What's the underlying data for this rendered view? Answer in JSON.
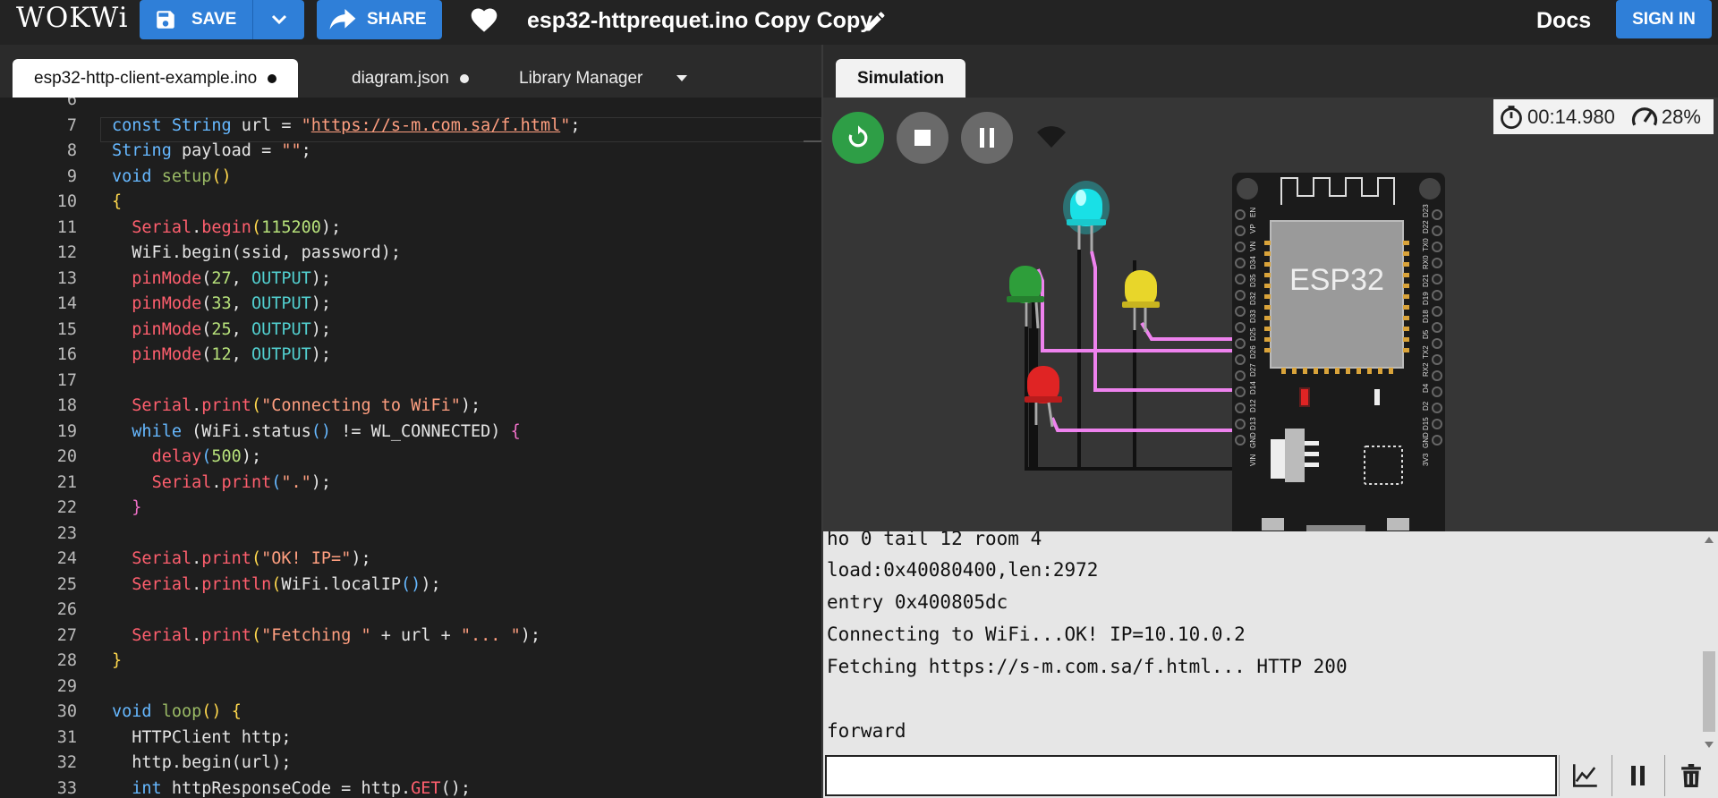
{
  "header": {
    "logo": "WOKWi",
    "save_label": "SAVE",
    "share_label": "SHARE",
    "project_title": "esp32-httprequet.ino Copy Copy",
    "docs_label": "Docs",
    "signin_label": "SIGN IN"
  },
  "editor_tabs": [
    {
      "label": "esp32-http-client-example.ino",
      "modified": true
    },
    {
      "label": "diagram.json",
      "modified": true
    },
    {
      "label": "Library Manager"
    }
  ],
  "simulation": {
    "tab_label": "Simulation",
    "timer": "00:14.980",
    "speed": "28%",
    "board_label": "ESP32",
    "led_colors": {
      "cyan": "#19e0e6",
      "green": "#2e9e3a",
      "yellow": "#e8d62a",
      "red": "#e02424"
    },
    "left_pins": [
      "EN",
      "VP",
      "VN",
      "D34",
      "D35",
      "D32",
      "D33",
      "D25",
      "D26",
      "D27",
      "D14",
      "D12",
      "D13",
      "GND",
      "VIN"
    ],
    "right_pins": [
      "D23",
      "D22",
      "TX0",
      "RX0",
      "D21",
      "D19",
      "D18",
      "D5",
      "TX2",
      "RX2",
      "D4",
      "D2",
      "D15",
      "GND",
      "3V3"
    ]
  },
  "code_lines": [
    {
      "n": "6"
    },
    {
      "n": "7"
    },
    {
      "n": "8"
    },
    {
      "n": "9"
    },
    {
      "n": "10"
    },
    {
      "n": "11"
    },
    {
      "n": "12"
    },
    {
      "n": "13"
    },
    {
      "n": "14"
    },
    {
      "n": "15"
    },
    {
      "n": "16"
    },
    {
      "n": "17"
    },
    {
      "n": "18"
    },
    {
      "n": "19"
    },
    {
      "n": "20"
    },
    {
      "n": "21"
    },
    {
      "n": "22"
    },
    {
      "n": "23"
    },
    {
      "n": "24"
    },
    {
      "n": "25"
    },
    {
      "n": "26"
    },
    {
      "n": "27"
    },
    {
      "n": "28"
    },
    {
      "n": "29"
    },
    {
      "n": "30"
    },
    {
      "n": "31"
    },
    {
      "n": "32"
    },
    {
      "n": "33"
    }
  ],
  "code": {
    "l7": {
      "a": "const String",
      "b": " url = ",
      "c": "\"",
      "d": "https://s-m.com.sa/f.html",
      "e": "\"",
      "f": ";"
    },
    "l8": {
      "a": "String",
      "b": " payload = ",
      "c": "\"\"",
      "d": ";"
    },
    "l9": {
      "a": "void",
      "b": " ",
      "c": "setup",
      "d": "()"
    },
    "l10": {
      "a": "{"
    },
    "l11": {
      "a": "  ",
      "b": "Serial",
      "c": ".",
      "d": "begin",
      "e": "(",
      "f": "115200",
      "g": ");"
    },
    "l12": {
      "a": "  WiFi.",
      "b": "begin",
      "c": "(ssid, password);"
    },
    "l13": {
      "a": "  ",
      "b": "pinMode",
      "c": "(",
      "d": "27",
      "e": ", ",
      "f": "OUTPUT",
      "g": ");"
    },
    "l14": {
      "a": "  ",
      "b": "pinMode",
      "c": "(",
      "d": "33",
      "e": ", ",
      "f": "OUTPUT",
      "g": ");"
    },
    "l15": {
      "a": "  ",
      "b": "pinMode",
      "c": "(",
      "d": "25",
      "e": ", ",
      "f": "OUTPUT",
      "g": ");"
    },
    "l16": {
      "a": "  ",
      "b": "pinMode",
      "c": "(",
      "d": "12",
      "e": ", ",
      "f": "OUTPUT",
      "g": ");"
    },
    "l18": {
      "a": "  ",
      "b": "Serial",
      "c": ".",
      "d": "print",
      "e": "(",
      "f": "\"Connecting to WiFi\"",
      "g": ");"
    },
    "l19": {
      "a": "  ",
      "b": "while",
      "c": " (",
      "d": "WiFi.",
      "e": "status",
      "f": "()",
      "g": " != WL_CONNECTED) ",
      "h": "{"
    },
    "l20": {
      "a": "    ",
      "b": "delay",
      "c": "(",
      "d": "500",
      "e": ");"
    },
    "l21": {
      "a": "    ",
      "b": "Serial",
      "c": ".",
      "d": "print",
      "e": "(",
      "f": "\".\"",
      "g": ");"
    },
    "l22": {
      "a": "  ",
      "b": "}"
    },
    "l24": {
      "a": "  ",
      "b": "Serial",
      "c": ".",
      "d": "print",
      "e": "(",
      "f": "\"OK! IP=\"",
      "g": ");"
    },
    "l25": {
      "a": "  ",
      "b": "Serial",
      "c": ".",
      "d": "println",
      "e": "(",
      "f": "WiFi.",
      "g": "localIP",
      "h": "()",
      "i": ");"
    },
    "l27": {
      "a": "  ",
      "b": "Serial",
      "c": ".",
      "d": "print",
      "e": "(",
      "f": "\"Fetching \"",
      "g": " + url + ",
      "h": "\"... \"",
      "i": ");"
    },
    "l28": {
      "a": "}"
    },
    "l30": {
      "a": "void",
      "b": " ",
      "c": "loop",
      "d": "() ",
      "e": "{"
    },
    "l31": {
      "a": "  HTTPClient http;"
    },
    "l32": {
      "a": "  http.",
      "b": "begin",
      "c": "(url);"
    },
    "l33": {
      "a": "  ",
      "b": "int",
      "c": " httpResponseCode = http.",
      "d": "GET",
      "e": "();"
    }
  },
  "serial_output": [
    "ho 0 tail 12 room 4",
    "load:0x40080400,len:2972",
    "entry 0x400805dc",
    "Connecting to WiFi...OK! IP=10.10.0.2",
    "Fetching https://s-m.com.sa/f.html... HTTP 200",
    "",
    "forward"
  ],
  "colors": {
    "accent": "#2f7fd8",
    "run_green": "#2e9e46",
    "wire_pink": "#ee82ee"
  }
}
